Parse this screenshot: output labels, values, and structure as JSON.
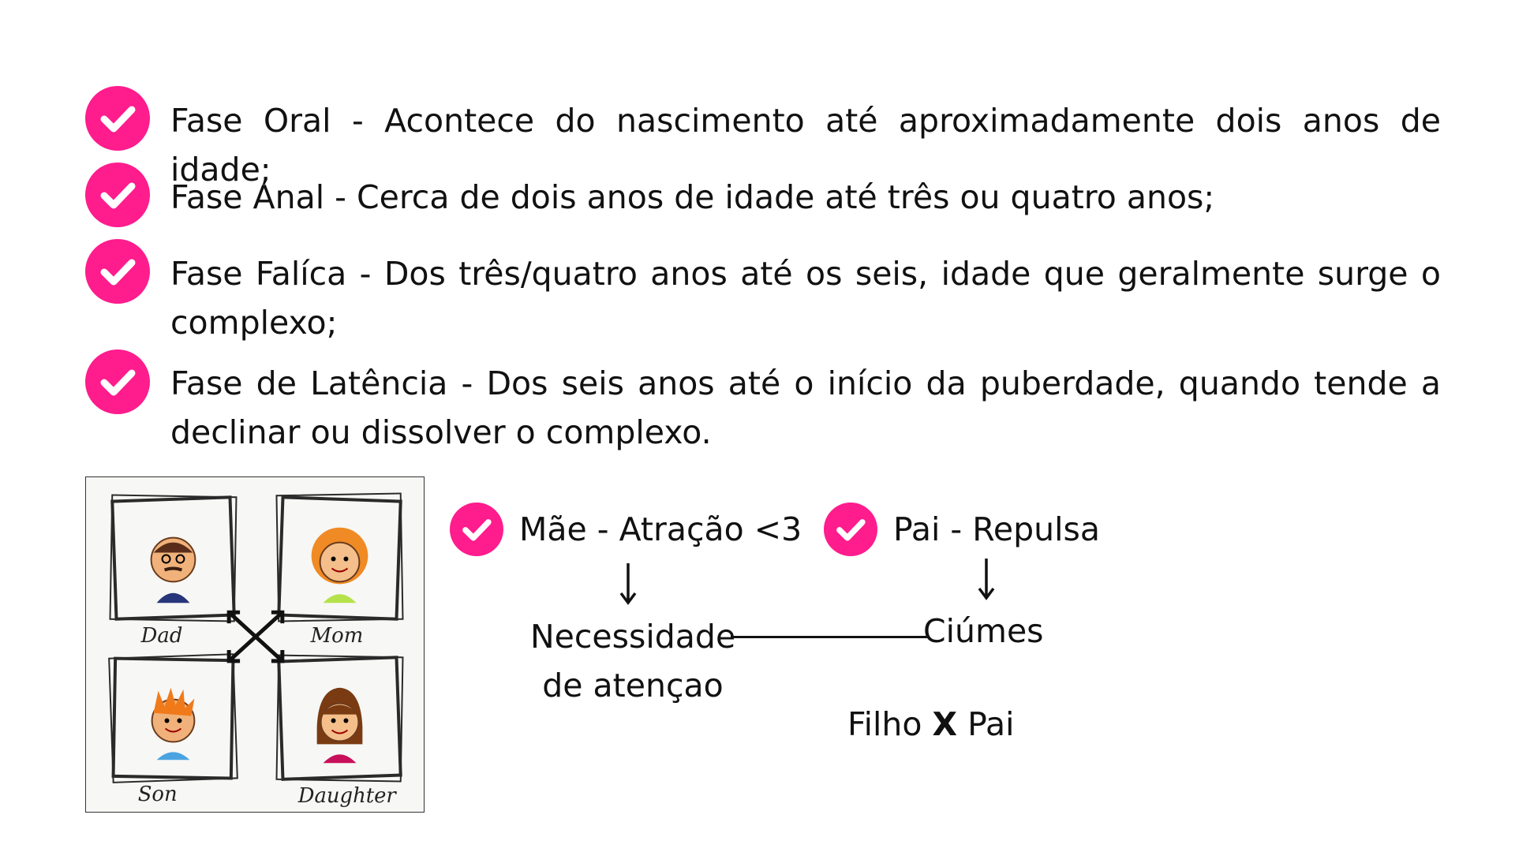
{
  "accent_color": "#ff1c8d",
  "phases": [
    {
      "text": "Fase Oral - Acontece do nascimento até aproximadamente dois anos de idade;"
    },
    {
      "text": "Fase Anal - Cerca de dois anos de idade até três ou quatro anos;"
    },
    {
      "text": "Fase Falíca - Dos três/quatro anos até os seis, idade que geralmente surge o complexo;"
    },
    {
      "text": "Fase de Latência - Dos seis anos até o início da puberdade, quando tende a declinar ou dissolver o complexo."
    }
  ],
  "family_image": {
    "labels": {
      "dad": "Dad",
      "mom": "Mom",
      "son": "Son",
      "daughter": "Daughter"
    }
  },
  "diagram": {
    "mae": "Mãe - Atração <3",
    "pai": "Pai - Repulsa",
    "necessidade_line1": "Necessidade",
    "necessidade_line2": "de atençao",
    "ciumes": "Ciúmes",
    "filho": "Filho",
    "x": "X",
    "pai_end": "Pai"
  },
  "icons": {
    "check": "check-circle-icon",
    "arrow": "arrow-down-icon"
  }
}
